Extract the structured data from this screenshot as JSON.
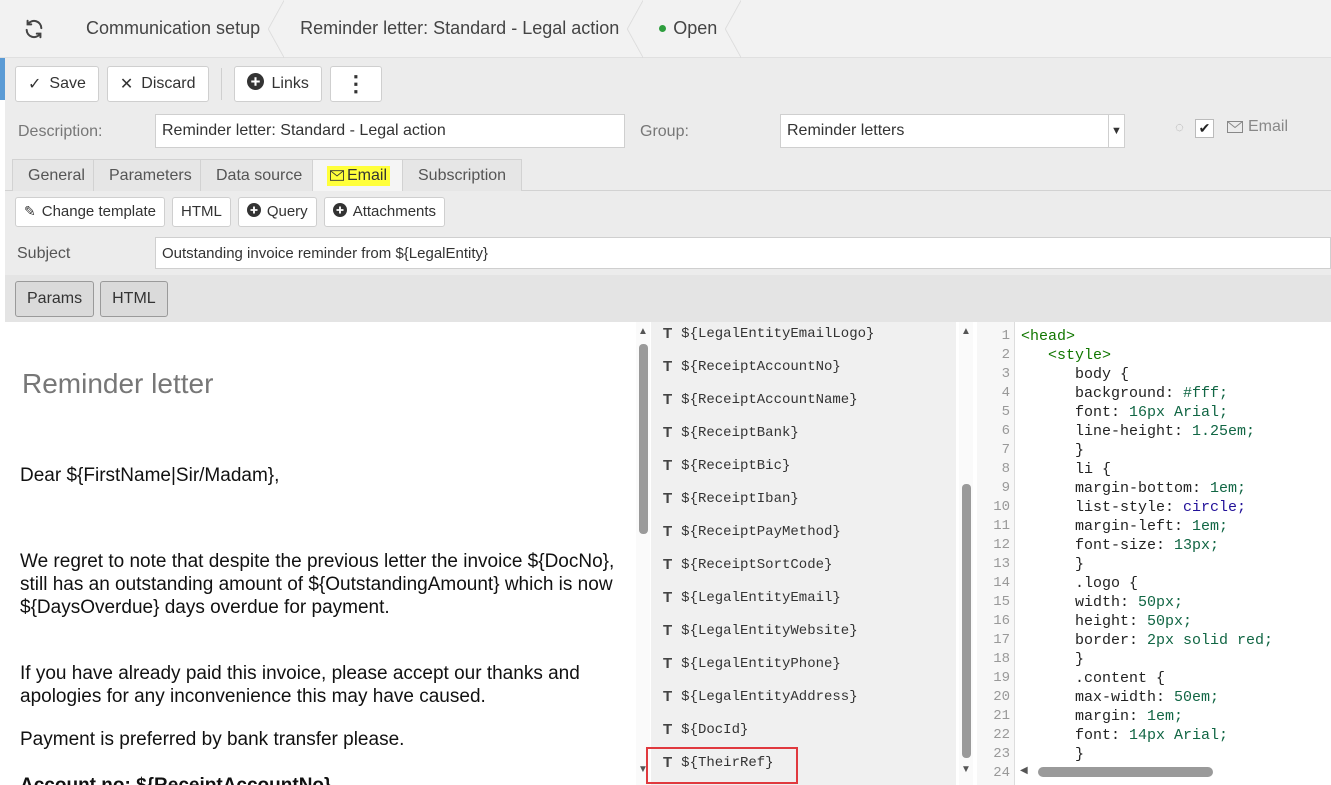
{
  "header": {
    "breadcrumb": [
      "Communication setup",
      "Reminder letter: Standard - Legal action"
    ],
    "status": "Open",
    "status_color": "#2e9e3e"
  },
  "toolbar": {
    "save_label": "Save",
    "discard_label": "Discard",
    "links_label": "Links",
    "more_label": "⋮"
  },
  "form": {
    "description_label": "Description:",
    "description_value": "Reminder letter: Standard - Legal action",
    "group_label": "Group:",
    "group_value": "Reminder letters",
    "email_label": "Email"
  },
  "tabs": [
    "General",
    "Parameters",
    "Data source",
    "Email",
    "Subscription"
  ],
  "active_tab": "Email",
  "email_toolbar": {
    "change_template": "Change template",
    "html": "HTML",
    "query": "Query",
    "attachments": "Attachments"
  },
  "subject": {
    "label": "Subject",
    "value": "Outstanding invoice reminder from ${LegalEntity}"
  },
  "mode_buttons": {
    "params": "Params",
    "html": "HTML"
  },
  "letter": {
    "title": "Reminder letter",
    "greeting": "Dear ${FirstName|Sir/Madam},",
    "para1": "We regret to note that despite the previous letter the invoice ${DocNo}, still has an outstanding amount of ${OutstandingAmount} which is now ${DaysOverdue} days overdue for payment.",
    "para2": "If you have already paid this invoice, please accept our thanks and apologies for any inconvenience this may have caused.",
    "para3": "Payment is preferred by bank transfer please.",
    "para4_partial": "Account no: ${ReceiptAccountNo}"
  },
  "params": [
    "${LegalEntityEmailLogo}",
    "${ReceiptAccountNo}",
    "${ReceiptAccountName}",
    "${ReceiptBank}",
    "${ReceiptBic}",
    "${ReceiptIban}",
    "${ReceiptPayMethod}",
    "${ReceiptSortCode}",
    "${LegalEntityEmail}",
    "${LegalEntityWebsite}",
    "${LegalEntityPhone}",
    "${LegalEntityAddress}",
    "${DocId}",
    "${TheirRef}"
  ],
  "param_type_glyph": "T",
  "highlighted_param": "${TheirRef}",
  "highlight_color": "#e0393e",
  "code": {
    "line_numbers": [
      "1",
      "2",
      "3",
      "4",
      "5",
      "6",
      "7",
      "8",
      "9",
      "10",
      "11",
      "12",
      "13",
      "14",
      "15",
      "16",
      "17",
      "18",
      "19",
      "20",
      "21",
      "22",
      "23",
      "24"
    ],
    "lines": [
      {
        "pre": "",
        "a": "<head>",
        "b": "",
        "c": ""
      },
      {
        "pre": "   ",
        "a": "<style>",
        "b": "",
        "c": ""
      },
      {
        "pre": "      ",
        "a": "",
        "b": "body {",
        "c": ""
      },
      {
        "pre": "      ",
        "a": "",
        "b": "background: ",
        "c": "#fff;"
      },
      {
        "pre": "      ",
        "a": "",
        "b": "font: ",
        "c": "16px Arial;"
      },
      {
        "pre": "      ",
        "a": "",
        "b": "line-height: ",
        "c": "1.25em;"
      },
      {
        "pre": "      ",
        "a": "",
        "b": "}",
        "c": ""
      },
      {
        "pre": "      ",
        "a": "",
        "b": "li {",
        "c": ""
      },
      {
        "pre": "      ",
        "a": "",
        "b": "margin-bottom: ",
        "c": "1em;"
      },
      {
        "pre": "      ",
        "a": "",
        "b": "list-style: ",
        "c": "circle;"
      },
      {
        "pre": "      ",
        "a": "",
        "b": "margin-left: ",
        "c": "1em;"
      },
      {
        "pre": "      ",
        "a": "",
        "b": "font-size: ",
        "c": "13px;"
      },
      {
        "pre": "      ",
        "a": "",
        "b": "}",
        "c": ""
      },
      {
        "pre": "      ",
        "a": "",
        "b": ".logo {",
        "c": ""
      },
      {
        "pre": "      ",
        "a": "",
        "b": "width: ",
        "c": "50px;"
      },
      {
        "pre": "      ",
        "a": "",
        "b": "height: ",
        "c": "50px;"
      },
      {
        "pre": "      ",
        "a": "",
        "b": "border: ",
        "c": "2px solid red;"
      },
      {
        "pre": "      ",
        "a": "",
        "b": "}",
        "c": ""
      },
      {
        "pre": "      ",
        "a": "",
        "b": ".content {",
        "c": ""
      },
      {
        "pre": "      ",
        "a": "",
        "b": "max-width: ",
        "c": "50em;"
      },
      {
        "pre": "      ",
        "a": "",
        "b": "margin: ",
        "c": "1em;"
      },
      {
        "pre": "      ",
        "a": "",
        "b": "font: ",
        "c": "14px Arial;"
      },
      {
        "pre": "      ",
        "a": "",
        "b": "}",
        "c": ""
      },
      {
        "pre": "",
        "a": "",
        "b": "",
        "c": ""
      }
    ]
  }
}
